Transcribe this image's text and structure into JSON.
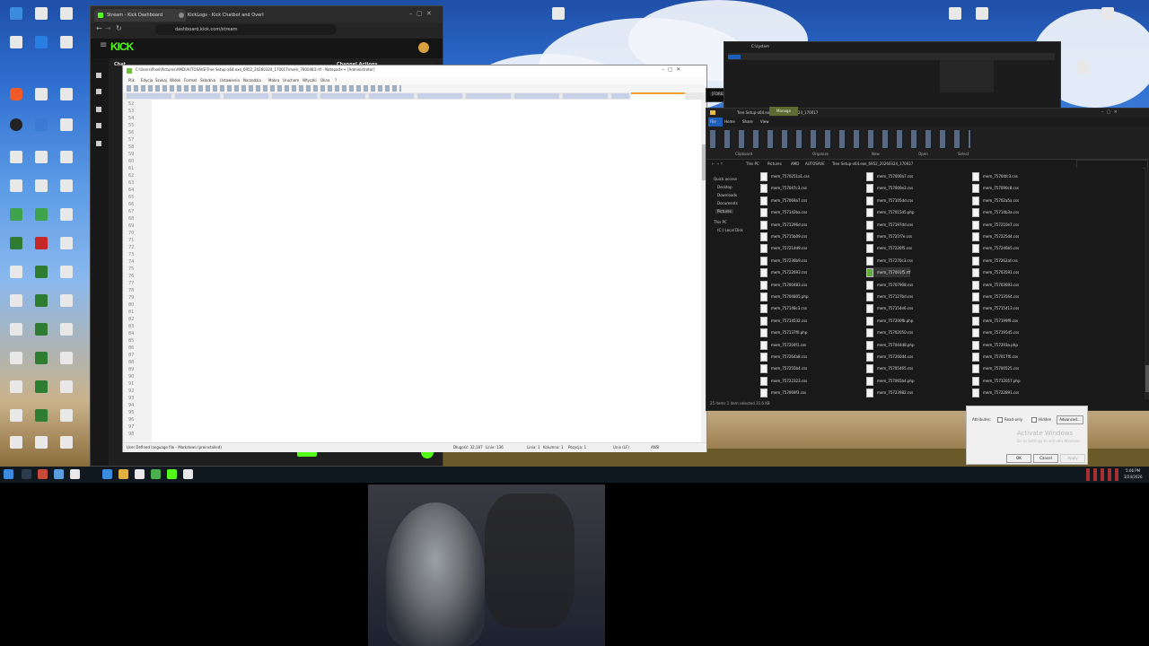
{
  "browser": {
    "tabs": [
      {
        "label": "Stream - Kick Dashboard",
        "active": true
      },
      {
        "label": "KickLogs - Kick Chatbot and Overl"
      }
    ],
    "url": "dashboard.kick.com/stream",
    "logo": "KICK",
    "chat_label": "Chat",
    "channel_actions": "Channel Actions"
  },
  "notepad": {
    "title": "C:\\Users\\Pixel\\Pictures\\AMD\\AUTOSAVE\\Tree Setup-x64.exe_6952_20260324_170017\\mem_7600483.rtf - Notepad++ [Administrator]",
    "menu": [
      "Plik",
      "Edycja",
      "Szukaj",
      "Widok",
      "Format",
      "Składnia",
      "Ustawienia",
      "Narzędzia",
      "Makra",
      "Uruchom",
      "Wtyczki",
      "Okna",
      "?"
    ],
    "line_numbers": [
      "52",
      "53",
      "54",
      "55",
      "56",
      "57",
      "58",
      "59",
      "60",
      "61",
      "62",
      "63",
      "64",
      "65",
      "66",
      "67",
      "68",
      "69",
      "70",
      "71",
      "72",
      "73",
      "74",
      "75",
      "76",
      "77",
      "78",
      "79",
      "80",
      "81",
      "82",
      "83",
      "84",
      "85",
      "86",
      "87",
      "88",
      "89",
      "90",
      "91",
      "92",
      "93",
      "94",
      "95",
      "96",
      "97",
      "98"
    ],
    "status": {
      "file_type": "User Defined language file - Markdown (preinstalled)",
      "length": "Długość: 32,187",
      "lines": "Linie: 136",
      "position": "Linia: 1",
      "column": "Kolumna: 1",
      "selection": "Pozycja: 1",
      "eol": "Unix (LF)",
      "encoding": "ANSI"
    }
  },
  "terminal": {
    "title": "C:\\system",
    "labels": [
      "[FORENSIC SCAN]",
      "[MEMORY VIZ]"
    ]
  },
  "explorer": {
    "title": "Tree Setup-x64.exe_6952_20260324_170017",
    "ribbon_tabs": [
      "File",
      "Home",
      "Share",
      "View"
    ],
    "manage_tab": "Manage",
    "groups": [
      "Clipboard",
      "Organize",
      "New",
      "Open",
      "Select"
    ],
    "path": [
      "This PC",
      "Pictures",
      "AMD",
      "AUTOSAVE",
      "Tree Setup-x64.exe_6952_20260324_170017"
    ],
    "nav": [
      "Quick access",
      "Desktop",
      "Downloads",
      "Documents",
      "Pictures",
      "This PC",
      "(C:) Local Disk"
    ],
    "files_col1": [
      "mem_7570251a1.css",
      "mem_757047c3.css",
      "mem_757069a7.css",
      "mem_757142ba.css",
      "mem_7571296d.css",
      "mem_75715b09.css",
      "mem_757214d9.css",
      "mem_757236b9.css",
      "mem_75722693.css",
      "mem_75700483.css",
      "mem_75704805.php",
      "mem_757148c3.css",
      "mem_75714532.css",
      "mem_757137f0.php",
      "mem_757204f1.css",
      "mem_757264a8.css",
      "mem_757255b4.css",
      "mem_75722323.css",
      "mem_757069f3.css",
      "mem_75721287.css"
    ],
    "files_col2": [
      "mem_757000a7.css",
      "mem_757000e3.css",
      "mem_757105dd.css",
      "mem_757015d5.php",
      "mem_757197dd.css",
      "mem_75721f7e.css",
      "mem_757226f5.css",
      "mem_757270c3.css",
      "mem_757001f5.rtf",
      "mem_75707908.css",
      "mem_757127bd.css",
      "mem_757154e6.css",
      "mem_757200fb.php",
      "mem_75702050.css",
      "mem_757044d8.php",
      "mem_757260d4.css",
      "mem_75705465.css",
      "mem_757065b4.php",
      "mem_75723982.css"
    ],
    "files_col3": [
      "mem_75704fc3.css",
      "mem_757090c8.css",
      "mem_75702a5a.css",
      "mem_75714b3a.css",
      "mem_757210e7.css",
      "mem_757225d4.css",
      "mem_757246b5.css",
      "mem_757262af.css",
      "mem_75703591.css",
      "mem_75703693.css",
      "mem_75713564.css",
      "mem_75715413.css",
      "mem_757199f9.css",
      "mem_757195d5.css",
      "mem_757293a.php",
      "mem_757017f0.css",
      "mem_75700525.css",
      "mem_75712057.php",
      "mem_75722891.css"
    ],
    "status": "25 items   1 item selected  31.6 KB"
  },
  "dialog": {
    "watermark_title": "Activate Windows",
    "watermark_sub": "Go to Settings to activate Windows.",
    "ok": "OK",
    "cancel": "Cancel",
    "apply": "Apply",
    "attributes": "Attributes:",
    "read_only": "Read-only",
    "hidden": "Hidden",
    "advanced": "Advanced..."
  },
  "clock": {
    "time": "5:06 PM",
    "date": "3/24/2026"
  },
  "colors": {
    "kick_green": "#53fc18",
    "explorer_bg": "#191919",
    "taskbar": "#101820"
  }
}
